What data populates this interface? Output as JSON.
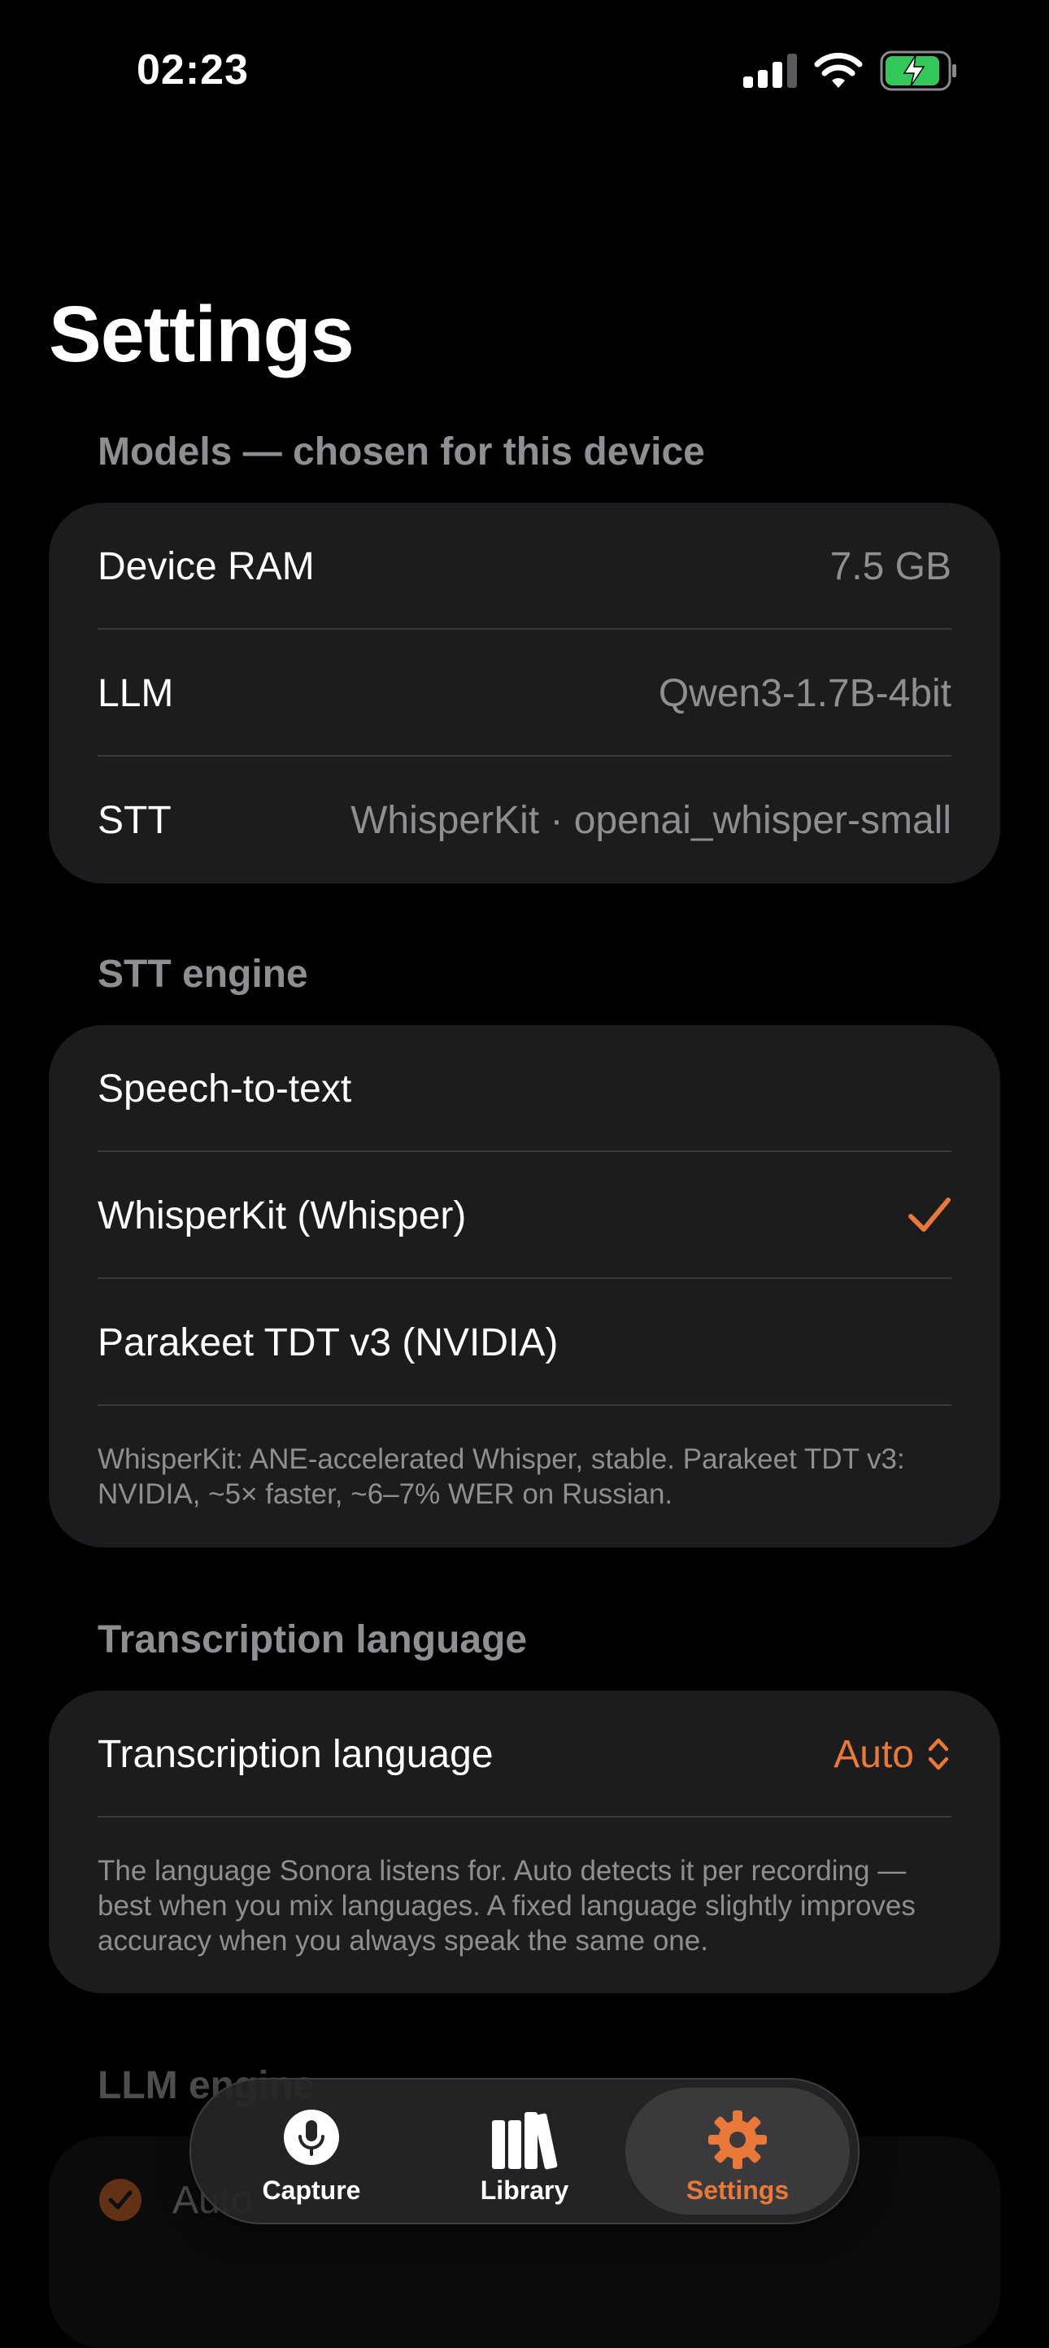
{
  "status_bar": {
    "time": "02:23"
  },
  "page": {
    "title": "Settings"
  },
  "models_section": {
    "header": "Models — chosen for this device",
    "rows": [
      {
        "label": "Device RAM",
        "value": "7.5 GB"
      },
      {
        "label": "LLM",
        "value": "Qwen3-1.7B-4bit"
      },
      {
        "label": "STT",
        "value": "WhisperKit · openai_whisper-small"
      }
    ]
  },
  "stt_section": {
    "header": "STT engine",
    "title_row": "Speech-to-text",
    "options": [
      {
        "label": "WhisperKit (Whisper)",
        "selected": true
      },
      {
        "label": "Parakeet TDT v3 (NVIDIA)",
        "selected": false
      }
    ],
    "footnote": "WhisperKit: ANE-accelerated Whisper, stable. Parakeet TDT v3: NVIDIA, ~5× faster, ~6–7% WER on Russian."
  },
  "language_section": {
    "header": "Transcription language",
    "row_label": "Transcription language",
    "row_value": "Auto",
    "footnote": "The language Sonora listens for. Auto detects it per recording — best when you mix languages. A fixed language slightly improves accuracy when you always speak the same one."
  },
  "llm_section": {
    "header": "LLM engine",
    "first_option": "Auto"
  },
  "tab_bar": {
    "tabs": [
      {
        "label": "Capture",
        "icon": "mic-icon"
      },
      {
        "label": "Library",
        "icon": "books-icon"
      },
      {
        "label": "Settings",
        "icon": "gear-icon"
      }
    ],
    "active": "Settings"
  },
  "colors": {
    "accent": "#e8793a",
    "card": "#1c1c1e",
    "secondary_text": "#8e8e93",
    "battery_green": "#34c759"
  }
}
